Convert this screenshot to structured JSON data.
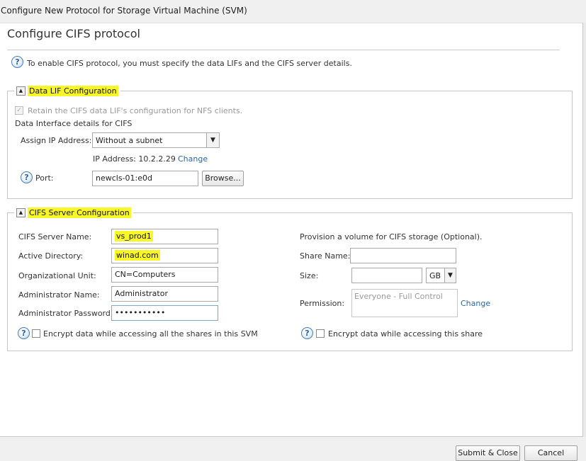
{
  "window": {
    "title": "Configure New Protocol for Storage Virtual Machine (SVM)"
  },
  "page": {
    "heading": "Configure CIFS protocol",
    "intro": "To enable CIFS protocol, you must specify the data LIFs and the CIFS server details."
  },
  "data_lif": {
    "legend": "Data LIF Configuration",
    "retain_label": "Retain the CIFS data LIF's configuration for NFS clients.",
    "details_label": "Data Interface details for CIFS",
    "assign_ip_label": "Assign IP Address:",
    "assign_ip_value": "Without a subnet",
    "ip_address_text": "IP Address: 10.2.2.29",
    "change_link": "Change",
    "port_label": "Port:",
    "port_value": "newcls-01:e0d",
    "browse_button": "Browse..."
  },
  "cifs_server": {
    "legend": "CIFS Server Configuration",
    "server_name_label": "CIFS Server Name:",
    "server_name_value": "vs_prod1",
    "active_directory_label": "Active Directory:",
    "active_directory_value": "winad.com",
    "org_unit_label": "Organizational Unit:",
    "org_unit_value": "CN=Computers",
    "admin_name_label": "Administrator Name:",
    "admin_name_value": "Administrator",
    "admin_password_label": "Administrator Password:",
    "admin_password_value": "•••••••••••",
    "encrypt_all_label": "Encrypt data while accessing all the shares in this SVM"
  },
  "provision": {
    "title": "Provision a volume for CIFS storage (Optional).",
    "share_name_label": "Share Name:",
    "share_name_value": "",
    "size_label": "Size:",
    "size_value": "",
    "size_unit": "GB",
    "permission_label": "Permission:",
    "permission_value": "Everyone - Full Control",
    "change_link": "Change",
    "encrypt_share_label": "Encrypt data while accessing this share"
  },
  "footer": {
    "submit_button": "Submit & Close",
    "cancel_button": "Cancel"
  },
  "icons": {
    "help": "help-icon",
    "collapse": "collapse-up-icon",
    "dropdown": "chevron-down-icon"
  },
  "colors": {
    "highlight": "#f8f628",
    "link": "#2a67a6"
  }
}
